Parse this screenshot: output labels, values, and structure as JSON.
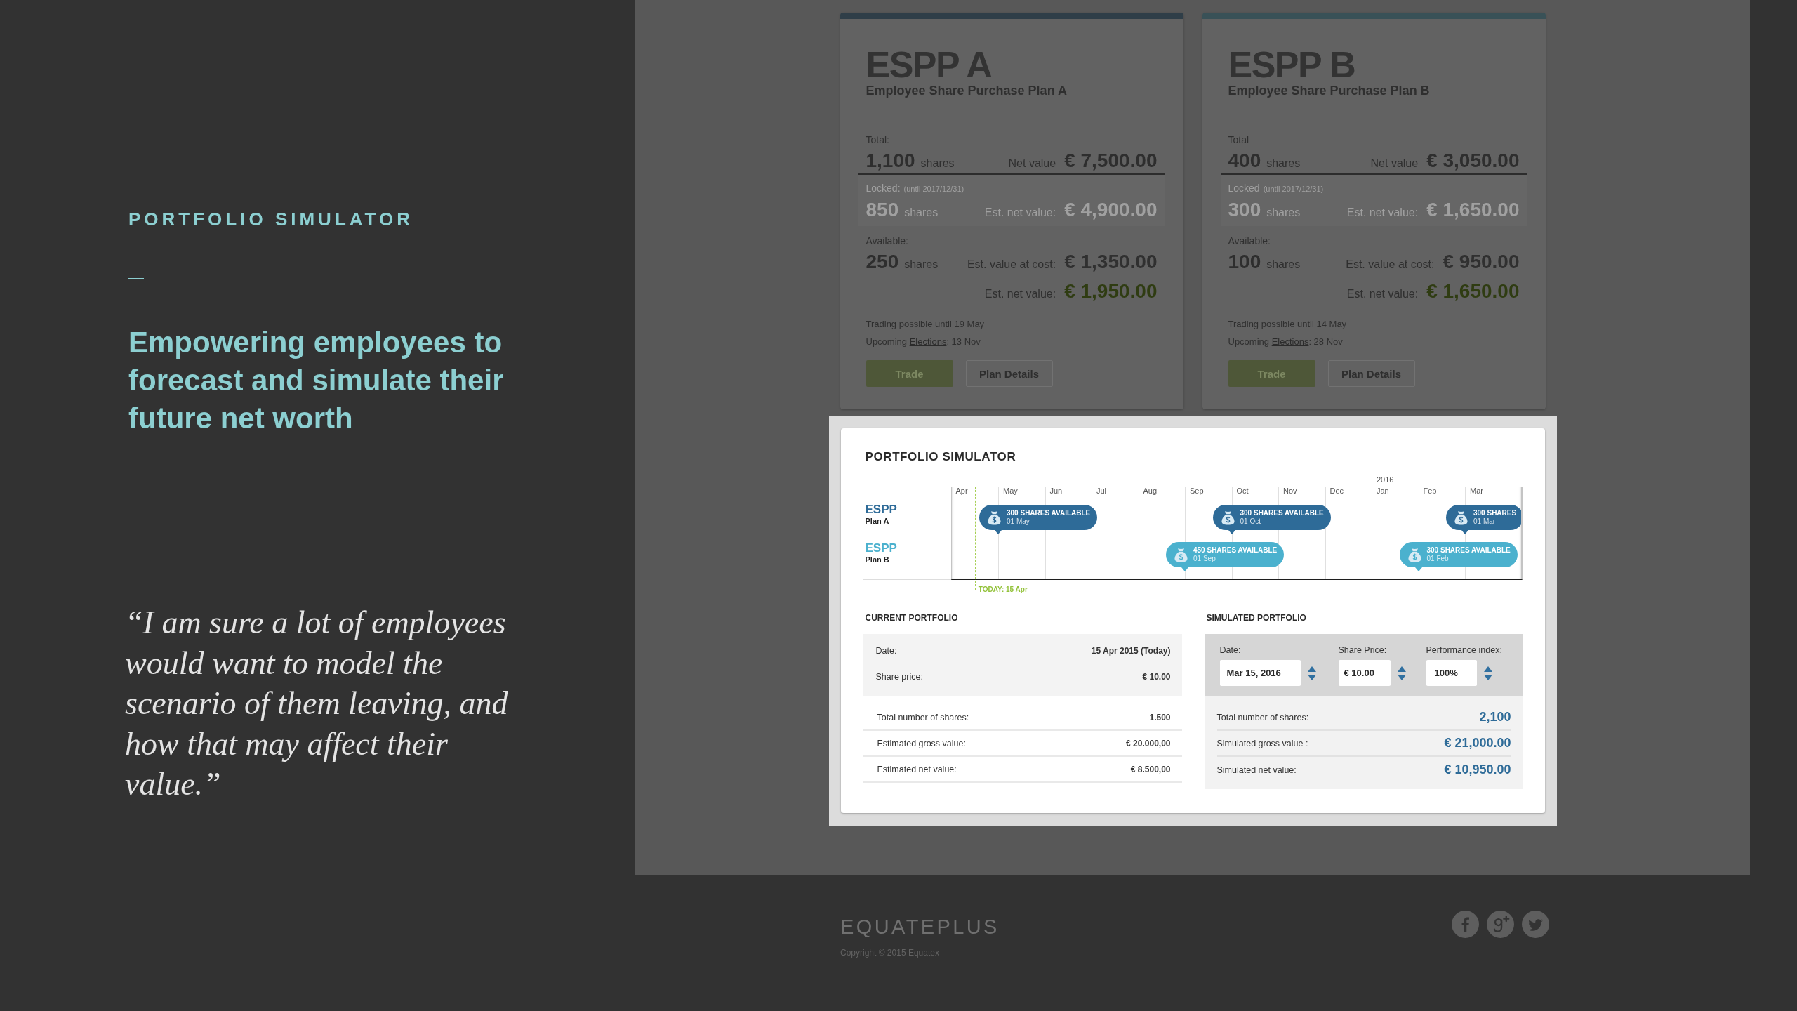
{
  "intro": {
    "eyebrow": "PORTFOLIO SIMULATOR",
    "headline": "Empowering employees to forecast and simulate their future net worth",
    "quote": "“I am sure a lot of employees would want to model the scenario of them leaving, and how that may affect their value.”"
  },
  "plans": [
    {
      "title": "ESPP A",
      "subtitle": "Employee Share Purchase Plan A",
      "color": "#2f3e48",
      "total": {
        "label": "Total:",
        "shares": "1,100",
        "unit": "shares",
        "value_label": "Net value",
        "value": "€ 7,500.00"
      },
      "locked": {
        "label": "Locked:",
        "note": "(until 2017/12/31)",
        "shares": "850",
        "unit": "shares",
        "value_label": "Est. net value:",
        "value": "€ 4,900.00"
      },
      "available": {
        "label": "Available:",
        "shares": "250",
        "unit": "shares",
        "values": [
          {
            "kind": "cost",
            "label": "Est. value at cost:",
            "value": "€ 1,350.00"
          },
          {
            "kind": "net",
            "label": "Est. net value:",
            "value": "€ 1,950.00"
          }
        ]
      },
      "trading_note": "Trading possible until 19 May",
      "elections": {
        "prefix": "Upcoming ",
        "link": "Elections",
        "suffix": ": 13 Nov"
      },
      "buttons": [
        {
          "label": "Trade",
          "kind": "primary"
        },
        {
          "label": "Plan Details",
          "kind": "secondary"
        }
      ]
    },
    {
      "title": "ESPP B",
      "subtitle": "Employee Share Purchase Plan B",
      "color": "#395157",
      "total": {
        "label": "Total",
        "shares": "400",
        "unit": "shares",
        "value_label": "Net value",
        "value": "€ 3,050.00"
      },
      "locked": {
        "label": "Locked",
        "note": "(until 2017/12/31)",
        "shares": "300",
        "unit": "shares",
        "value_label": "Est. net value:",
        "value": "€ 1,650.00"
      },
      "available": {
        "label": "Available:",
        "shares": "100",
        "unit": "shares",
        "values": [
          {
            "kind": "cost",
            "label": "Est. value at cost:",
            "value": "€ 950.00"
          },
          {
            "kind": "net",
            "label": "Est. net value:",
            "value": "€ 1,650.00"
          }
        ]
      },
      "trading_note": "Trading possible until 14 May",
      "elections": {
        "prefix": "Upcoming ",
        "link": "Elections",
        "suffix": ": 28 Nov"
      },
      "buttons": [
        {
          "label": "Trade",
          "kind": "primary"
        },
        {
          "label": "Plan Details",
          "kind": "secondary"
        }
      ]
    }
  ],
  "simulator": {
    "title": "PORTFOLIO SIMULATOR",
    "timeline": {
      "rows": [
        {
          "name": "ESPP",
          "plan": "Plan A",
          "color": "#2e6b98"
        },
        {
          "name": "ESPP",
          "plan": "Plan B",
          "color": "#4bb1ce"
        }
      ],
      "months": [
        {
          "label": "Apr",
          "today": "TODAY: 15 Apr"
        },
        {
          "label": "May",
          "events": [
            {
              "kind": "plan_a",
              "title": "300 SHARES AVAILABLE",
              "date": "01 May"
            }
          ]
        },
        {
          "label": "Jun"
        },
        {
          "label": "Jul"
        },
        {
          "label": "Aug"
        },
        {
          "label": "Sep",
          "events": [
            {
              "kind": "plan_b",
              "title": "450 SHARES AVAILABLE",
              "date": "01 Sep"
            }
          ]
        },
        {
          "label": "Oct",
          "events": [
            {
              "kind": "plan_a",
              "title": "300 SHARES AVAILABLE",
              "date": "01 Oct"
            }
          ]
        },
        {
          "label": "Nov"
        },
        {
          "label": "Dec"
        },
        {
          "label": "Jan",
          "year": "2016"
        },
        {
          "label": "Feb",
          "events": [
            {
              "kind": "plan_b",
              "title": "300 SHARES AVAILABLE",
              "date": "01 Feb"
            }
          ]
        },
        {
          "label": "Mar",
          "events": [
            {
              "kind": "plan_a",
              "title": "300 SHARES",
              "date": "01 Mar"
            }
          ]
        }
      ]
    },
    "current": {
      "title": "CURRENT PORTFOLIO",
      "summary": [
        {
          "label": "Date:",
          "value": "15 Apr 2015 (Today)"
        },
        {
          "label": "Share price:",
          "value": "€ 10.00"
        }
      ],
      "rows": [
        {
          "label": "Total number of shares:",
          "value": "1.500"
        },
        {
          "label": "Estimated gross value:",
          "value": "€ 20.000,00"
        },
        {
          "label": "Estimated net value:",
          "value": "€ 8.500,00"
        }
      ]
    },
    "simulated": {
      "title": "SIMULATED PORTFOLIO",
      "fields": [
        {
          "label": "Date:",
          "value": "Mar 15, 2016"
        },
        {
          "label": "Share Price:",
          "value": "€ 10.00"
        },
        {
          "label": "Performance index:",
          "value": "100%"
        }
      ],
      "rows": [
        {
          "label": "Total number of shares:",
          "value": "2,100"
        },
        {
          "label": "Simulated gross value :",
          "value": "€ 21,000.00"
        },
        {
          "label": "Simulated net value:",
          "value": "€ 10,950.00"
        }
      ]
    }
  },
  "footer": {
    "logo": "EQUATEPLUS",
    "copyright": "Copyright © 2015 Equatex",
    "social": [
      {
        "kind": "facebook"
      },
      {
        "kind": "google_plus"
      },
      {
        "kind": "twitter"
      }
    ]
  }
}
